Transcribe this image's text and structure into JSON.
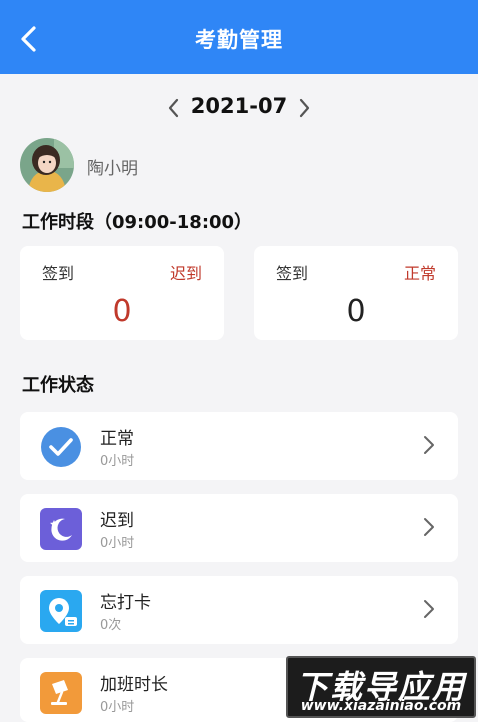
{
  "header": {
    "title": "考勤管理",
    "back_icon": "chevron-left-icon"
  },
  "month": {
    "label": "2021-07",
    "prev_icon": "chevron-left-icon",
    "next_icon": "chevron-right-icon"
  },
  "user": {
    "name": "陶小明"
  },
  "work_period": {
    "title": "工作时段（09:00-18:00）",
    "cards": [
      {
        "label": "签到",
        "status": "迟到",
        "value": "0",
        "status_color": "#c0392b",
        "value_color": "#c0392b"
      },
      {
        "label": "签到",
        "status": "正常",
        "value": "0",
        "status_color": "#c0392b",
        "value_color": "#222222"
      }
    ]
  },
  "work_status": {
    "title": "工作状态",
    "items": [
      {
        "label": "正常",
        "value": "0小时",
        "icon": "check-circle-icon",
        "color": "#4a90e2"
      },
      {
        "label": "迟到",
        "value": "0小时",
        "icon": "moon-icon",
        "color": "#6c5fd9"
      },
      {
        "label": "忘打卡",
        "value": "0次",
        "icon": "location-pin-icon",
        "color": "#2aa8f0"
      },
      {
        "label": "加班时长",
        "value": "0小时",
        "icon": "lamp-icon",
        "color": "#f29a3a"
      }
    ]
  },
  "watermark": {
    "title": "下载导应用",
    "url": "www.xiazainiao.com"
  }
}
